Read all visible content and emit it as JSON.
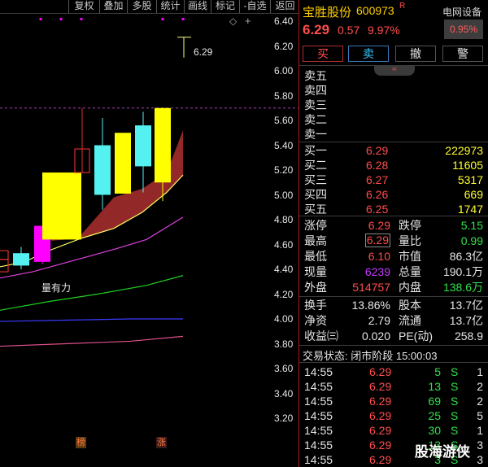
{
  "toolbar": {
    "items": [
      "复权",
      "叠加",
      "多股",
      "统计",
      "画线",
      "标记",
      "-自选",
      "返回"
    ]
  },
  "chart": {
    "y_ticks": [
      "6.40",
      "6.20",
      "6.00",
      "5.80",
      "5.60",
      "5.40",
      "5.20",
      "5.00",
      "4.80",
      "4.60",
      "4.40",
      "4.20",
      "4.00",
      "3.80",
      "3.60",
      "3.40",
      "3.20"
    ],
    "high_annotation": "6.29",
    "volume_note": "量有力",
    "badges": [
      "榜",
      "涨"
    ],
    "candles": [
      {
        "open": 4.43,
        "close": 4.53,
        "high": 4.58,
        "low": 4.4,
        "color": "cyan"
      },
      {
        "open": 4.46,
        "close": 4.75,
        "high": 4.75,
        "low": 4.44,
        "color": "magenta"
      },
      {
        "open": 4.64,
        "close": 5.18,
        "high": 5.18,
        "low": 4.64,
        "color": "yellow"
      },
      {
        "open": 5.37,
        "close": 5.18,
        "high": 5.7,
        "low": 5.18,
        "color": "red_hollow"
      },
      {
        "open": 5.0,
        "close": 5.4,
        "high": 5.62,
        "low": 4.88,
        "color": "cyan"
      },
      {
        "open": 5.01,
        "close": 5.5,
        "high": 5.5,
        "low": 5.01,
        "color": "yellow"
      },
      {
        "open": 5.23,
        "close": 5.56,
        "high": 5.67,
        "low": 5.02,
        "color": "cyan"
      },
      {
        "open": 5.1,
        "close": 5.7,
        "high": 5.7,
        "low": 4.95,
        "color": "yellow"
      }
    ],
    "colors": {
      "yellow": "#ffff00",
      "cyan": "#55f0f0",
      "magenta": "#ff00ff",
      "red": "#d8302e",
      "band": "#9a2a2a",
      "ma_yellow": "#ffff60",
      "ma_magenta": "#dd40dd",
      "ma_green": "#20d020",
      "ma_blue": "#3a3aff",
      "ma_pink": "#e0508a"
    }
  },
  "header": {
    "name": "宝胜股份",
    "code": "600973",
    "flag": "R",
    "price": "6.29",
    "change": "0.57",
    "change_pct": "9.97%",
    "sector": "电网设备",
    "sector_pct": "0.95%"
  },
  "trade_buttons": [
    "买",
    "卖",
    "撤",
    "警"
  ],
  "asks": [
    {
      "label": "卖五",
      "price": "",
      "vol": ""
    },
    {
      "label": "卖四",
      "price": "",
      "vol": ""
    },
    {
      "label": "卖三",
      "price": "",
      "vol": ""
    },
    {
      "label": "卖二",
      "price": "",
      "vol": ""
    },
    {
      "label": "卖一",
      "price": "",
      "vol": ""
    }
  ],
  "bids": [
    {
      "label": "买一",
      "price": "6.29",
      "vol": "222973"
    },
    {
      "label": "买二",
      "price": "6.28",
      "vol": "11605"
    },
    {
      "label": "买三",
      "price": "6.27",
      "vol": "5317"
    },
    {
      "label": "买四",
      "price": "6.26",
      "vol": "669"
    },
    {
      "label": "买五",
      "price": "6.25",
      "vol": "1747"
    }
  ],
  "stats": [
    {
      "l1": "涨停",
      "v1": "6.29",
      "c1": "red",
      "l2": "跌停",
      "v2": "5.15",
      "c2": "green"
    },
    {
      "l1": "最高",
      "v1": "6.29",
      "c1": "red",
      "l2": "量比",
      "v2": "0.99",
      "c2": "green"
    },
    {
      "l1": "最低",
      "v1": "6.10",
      "c1": "red",
      "l2": "市值",
      "v2": "86.3亿",
      "c2": "white"
    },
    {
      "l1": "现量",
      "v1": "6239",
      "c1": "magenta",
      "l2": "总量",
      "v2": "190.1万",
      "c2": "white"
    },
    {
      "l1": "外盘",
      "v1": "514757",
      "c1": "red",
      "l2": "内盘",
      "v2": "138.6万",
      "c2": "green"
    }
  ],
  "stats2": [
    {
      "l1": "换手",
      "v1": "13.86%",
      "l2": "股本",
      "v2": "13.7亿"
    },
    {
      "l1": "净资",
      "v1": "2.79",
      "l2": "流通",
      "v2": "13.7亿"
    },
    {
      "l1": "收益㈢",
      "v1": "0.020",
      "l2": "PE(动)",
      "v2": "258.9"
    }
  ],
  "trade_status": "交易状态: 闭市阶段 15:00:03",
  "ticks": [
    {
      "time": "14:55",
      "price": "6.29",
      "vol": "5",
      "side": "S",
      "num": "1"
    },
    {
      "time": "14:55",
      "price": "6.29",
      "vol": "13",
      "side": "S",
      "num": "2"
    },
    {
      "time": "14:55",
      "price": "6.29",
      "vol": "69",
      "side": "S",
      "num": "2"
    },
    {
      "time": "14:55",
      "price": "6.29",
      "vol": "25",
      "side": "S",
      "num": "5"
    },
    {
      "time": "14:55",
      "price": "6.29",
      "vol": "30",
      "side": "S",
      "num": "1"
    },
    {
      "time": "14:55",
      "price": "6.29",
      "vol": "13",
      "side": "S",
      "num": "3"
    },
    {
      "time": "14:55",
      "price": "6.29",
      "vol": "3",
      "side": "S",
      "num": "3"
    }
  ],
  "watermark": "股海游侠"
}
